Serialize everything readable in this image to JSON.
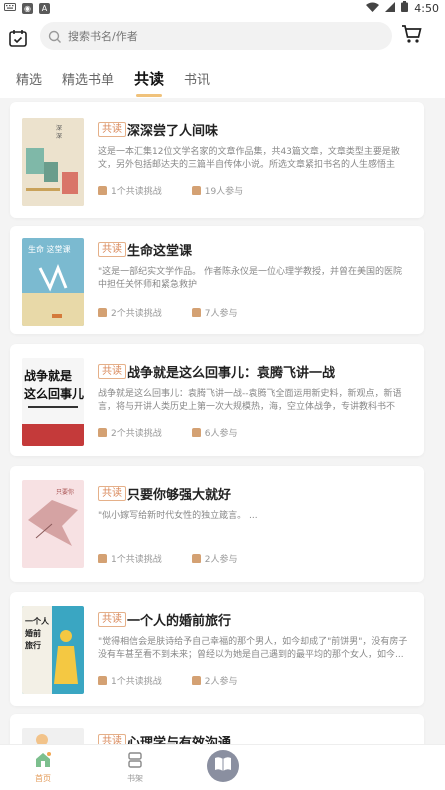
{
  "status": {
    "time": "4:50"
  },
  "search": {
    "placeholder": "搜索书名/作者"
  },
  "tabs": [
    {
      "label": "精选"
    },
    {
      "label": "精选书单"
    },
    {
      "label": "共读"
    },
    {
      "label": "书讯"
    }
  ],
  "active_tab": "共读",
  "cards": [
    {
      "tag": "共读",
      "title": "深深尝了人间味",
      "desc": "这是一本汇集12位文学名家的文章作品集，共43篇文章，文章类型主要是散文，另外包括邮达夫的三篇半自传体小说。所选文章紧扣书名的人生感悟主",
      "challenges": "1个共读挑战",
      "participants": "19人参与",
      "cover_title": "深深尝了人间味",
      "cover_color": "#e9dcc3"
    },
    {
      "tag": "共读",
      "title": "生命这堂课",
      "desc": "\"这是一部纪实文学作品。\n作者陈永仪是一位心理学教授，并曾在美国的医院中担任关怀师和紧急救护",
      "challenges": "2个共读挑战",
      "participants": "7人参与",
      "cover_title": "生命 这堂课",
      "cover_color": "#6fb0c9"
    },
    {
      "tag": "共读",
      "title": "战争就是这么回事儿：袁腾飞讲一战",
      "desc": "战争就是这么回事儿：袁腾飞讲一战--袁腾飞全面运用新史料，新观点，新语言，将与开讲人类历史上第一次大规模热，海，空立体战争，专讲教科书不",
      "challenges": "2个共读挑战",
      "participants": "6人参与",
      "cover_title": "战争就是 这么回事儿",
      "cover_color": "#f2f2f2"
    },
    {
      "tag": "共读",
      "title": "只要你够强大就好",
      "desc": "\"似小嫁写给新时代女性的独立箴言。\n...",
      "challenges": "1个共读挑战",
      "participants": "2人参与",
      "cover_title": "只要你够强大就好",
      "cover_color": "#f4dcdf"
    },
    {
      "tag": "共读",
      "title": "一个人的婚前旅行",
      "desc": "\"觉得相信会是肤诗给予自己幸福的那个男人，如今却成了\"前饼男\"，没有房子没有车甚至看不到未来；曾经以为她是自己遇到的最平均的那个女人，如今...",
      "challenges": "1个共读挑战",
      "participants": "2人参与",
      "cover_title": "一个人的 婚前 旅行",
      "cover_color": "#3aa6c2"
    },
    {
      "tag": "共读",
      "title": "心理学与有效沟通",
      "desc": "",
      "challenges": "",
      "participants": "",
      "cover_title": "",
      "cover_color": "#f0f0f0"
    }
  ],
  "nav": {
    "home": "首页",
    "shelf": "书架"
  },
  "colors": {
    "accent": "#e39c5b",
    "tag_border": "#e5b089",
    "underline": "#f0c27b"
  }
}
